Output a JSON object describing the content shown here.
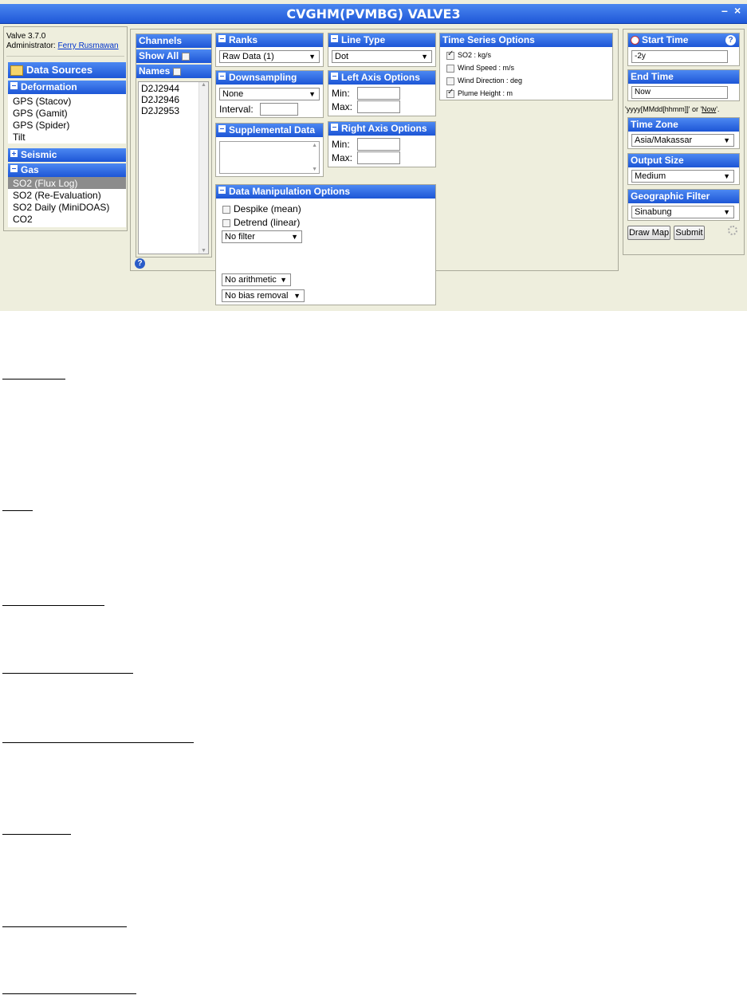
{
  "app": {
    "title": "CVGHM(PVMBG) VALVE3",
    "minimize_glyph": "–",
    "close_glyph": "×",
    "version": "Valve 3.7.0",
    "admin_label": "Administrator:",
    "admin_name": "Ferry Rusmawan"
  },
  "data_sources": {
    "title": "Data Sources",
    "groups": [
      {
        "label": "Deformation",
        "items": [
          "GPS (Stacov)",
          "GPS (Gamit)",
          "GPS (Spider)",
          "Tilt"
        ]
      },
      {
        "label": "Seismic",
        "items": []
      },
      {
        "label": "Gas",
        "items": [
          "SO2 (Flux Log)",
          "SO2 (Re-Evaluation)",
          "SO2 Daily (MiniDOAS)",
          "CO2"
        ],
        "selected": "SO2 (Flux Log)"
      }
    ]
  },
  "channels": {
    "title": "Channels",
    "show_all": "Show All",
    "names": "Names",
    "items": [
      "D2J2944",
      "D2J2946",
      "D2J2953"
    ]
  },
  "ranks": {
    "title": "Ranks",
    "value": "Raw Data (1)"
  },
  "downsampling": {
    "title": "Downsampling",
    "value": "None",
    "interval_label": "Interval:"
  },
  "supplemental": {
    "title": "Supplemental Data"
  },
  "manipulation": {
    "title": "Data Manipulation Options",
    "despike": "Despike (mean)",
    "detrend": "Detrend (linear)",
    "filter": "No filter",
    "arithmetic": "No arithmetic",
    "bias": "No bias removal"
  },
  "line_type": {
    "title": "Line Type",
    "value": "Dot"
  },
  "left_axis": {
    "title": "Left Axis Options",
    "min": "Min:",
    "max": "Max:"
  },
  "right_axis": {
    "title": "Right Axis Options",
    "min": "Min:",
    "max": "Max:"
  },
  "time_series": {
    "title": "Time Series Options",
    "options": [
      {
        "label": "SO2 : kg/s",
        "checked": true
      },
      {
        "label": "Wind Speed : m/s",
        "checked": false
      },
      {
        "label": "Wind Direction : deg",
        "checked": false
      },
      {
        "label": "Plume Height : m",
        "checked": true
      }
    ]
  },
  "right_panel": {
    "start_title": "Start Time",
    "start_value": "-2y",
    "end_title": "End Time",
    "end_value": "Now",
    "format_hint_1": "'yyyy[MMdd[hhmm]]' or '",
    "format_hint_now": "Now",
    "format_hint_2": "'.",
    "tz_title": "Time Zone",
    "tz_value": "Asia/Makassar",
    "size_title": "Output Size",
    "size_value": "Medium",
    "geo_title": "Geographic Filter",
    "geo_value": "Sinabung",
    "draw_map": "Draw Map",
    "submit": "Submit"
  },
  "help_glyph": "?",
  "colors": {
    "header_blue": "#1d56d6",
    "panel_bg": "#eeeedd",
    "selected_row": "#8c8c8c"
  }
}
